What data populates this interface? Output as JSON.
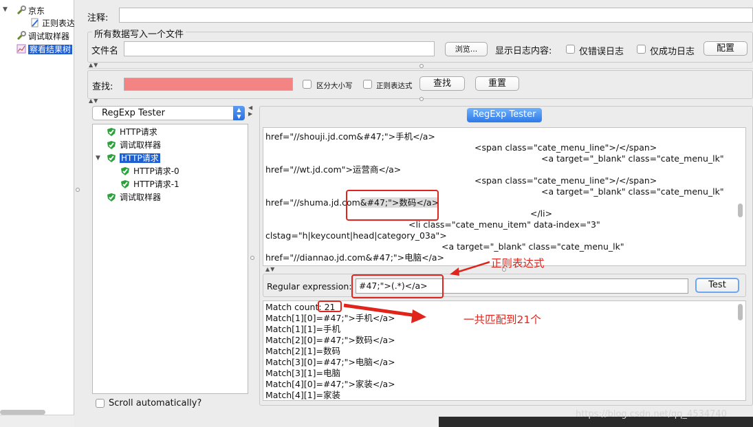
{
  "left_tree": {
    "items": [
      {
        "label": "京东",
        "icon": "wrench-icon"
      },
      {
        "label": "正则表达",
        "icon": "pencil-icon"
      },
      {
        "label": "调试取样器",
        "icon": "wrench-icon"
      },
      {
        "label": "察看结果树",
        "icon": "chart-icon"
      }
    ]
  },
  "top_form": {
    "comment_label": "注释:",
    "comment_value": "",
    "group_title": "所有数据写入一个文件",
    "filename_label": "文件名",
    "filename_value": "",
    "browse_label": "浏览...",
    "log_content_label": "显示日志内容:",
    "errors_only_label": "仅错误日志",
    "success_only_label": "仅成功日志",
    "configure_label": "配置"
  },
  "search_bar": {
    "find_label": "查找:",
    "case_sensitive_label": "区分大小写",
    "regex_label": "正则表达式",
    "search_button": "查找",
    "reset_button": "重置"
  },
  "view_selector": {
    "selected": "RegExp Tester"
  },
  "result_tree": {
    "items": [
      {
        "label": "HTTP请求"
      },
      {
        "label": "调试取样器"
      },
      {
        "label": "HTTP请求"
      },
      {
        "label": "HTTP请求-0"
      },
      {
        "label": "HTTP请求-1"
      },
      {
        "label": "调试取样器"
      }
    ],
    "scroll_auto_label": "Scroll automatically?"
  },
  "regexp_tester": {
    "tab_label": "RegExp Tester",
    "response_lines": [
      "href=\"//shouji.jd.com&#47;\">手机</a>",
      "<span class=\"cate_menu_line\">/</span>",
      "<a target=\"_blank\" class=\"cate_menu_lk\"",
      "href=\"//wt.jd.com\">运营商</a>",
      "<span class=\"cate_menu_line\">/</span>",
      "<a target=\"_blank\" class=\"cate_menu_lk\"",
      "href=\"//shuma.jd.com",
      "&#47;\">数码</a>",
      "</li>",
      "<li class=\"cate_menu_item\" data-index=\"3\"",
      "clstag=\"h|keycount|head|category_03a\">",
      "<a target=\"_blank\" class=\"cate_menu_lk\"",
      "href=\"//diannao.jd.com&#47;\">电脑</a>"
    ],
    "regex_label": "Regular expression:",
    "regex_value": "#47;\">(.*)</a>",
    "test_button": "Test",
    "match_lines": [
      "Match count",
      ": 21",
      "Match[1][0]=#47;\">手机</a>",
      "Match[1][1]=手机",
      "Match[2][0]=#47;\">数码</a>",
      "Match[2][1]=数码",
      "Match[3][0]=#47;\">电脑</a>",
      "Match[3][1]=电脑",
      "Match[4][0]=#47;\">家装</a>",
      "Match[4][1]=家装"
    ]
  },
  "annotations": {
    "regex_note": "正则表达式",
    "count_note": "一共匹配到21个",
    "color": "#e0241b"
  },
  "watermark": "https://blog.csdn.net/qq_4534740"
}
